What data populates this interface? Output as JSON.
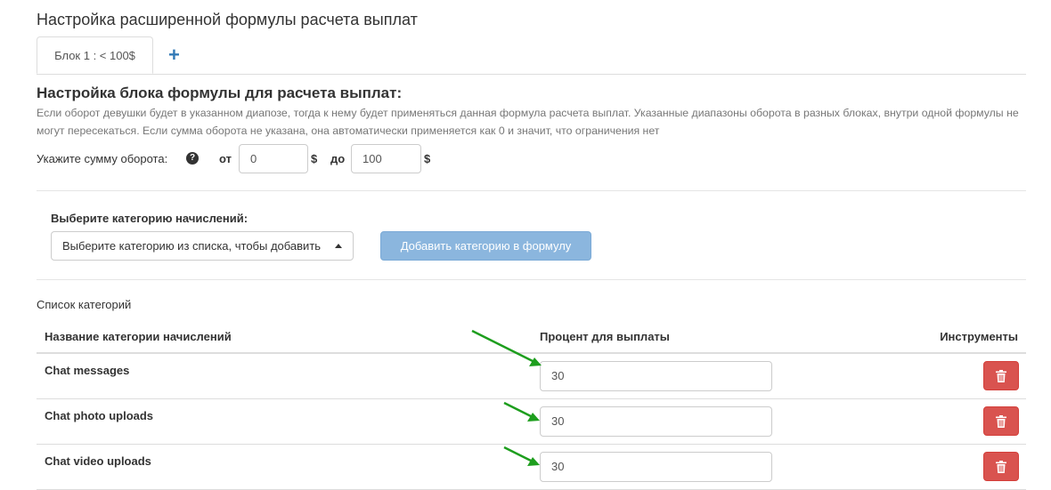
{
  "page_title": "Настройка расширенной формулы расчета выплат",
  "tabs": [
    {
      "label": "Блок 1 : < 100$"
    }
  ],
  "tab_add_label": "+",
  "block": {
    "heading": "Настройка блока формулы для расчета выплат:",
    "description": "Если оборот девушки будет в указанном диапозе, тогда к нему будет применяться данная формула расчета выплат. Указанные диапазоны оборота в разных блоках, внутри одной формулы не могут пересекаться. Если сумма оборота не указана, она автоматически применяется как 0 и значит, что ограничения нет"
  },
  "range": {
    "label": "Укажите сумму оборота:",
    "from_label": "от",
    "from_value": "0",
    "to_label": "до",
    "to_value": "100",
    "currency": "$"
  },
  "category_select": {
    "label": "Выберите категорию начислений:",
    "value": "Выберите категорию из списка, чтобы добавить"
  },
  "add_category_button": "Добавить категорию в формулу",
  "category_list": {
    "title": "Список категорий",
    "columns": [
      "Название категории начислений",
      "Процент для выплаты",
      "Инструменты"
    ],
    "rows": [
      {
        "name": "Chat messages",
        "percent": "30"
      },
      {
        "name": "Chat photo uploads",
        "percent": "30"
      },
      {
        "name": "Chat video uploads",
        "percent": "30"
      }
    ]
  },
  "colors": {
    "primary": "#337ab7",
    "button_disabled": "#8bb6de",
    "danger": "#d9534f",
    "annotation_arrow": "#1e9e1e"
  },
  "icons": {
    "help": "question-circle-icon",
    "delete": "trash-icon",
    "select": "caret-up-icon"
  }
}
